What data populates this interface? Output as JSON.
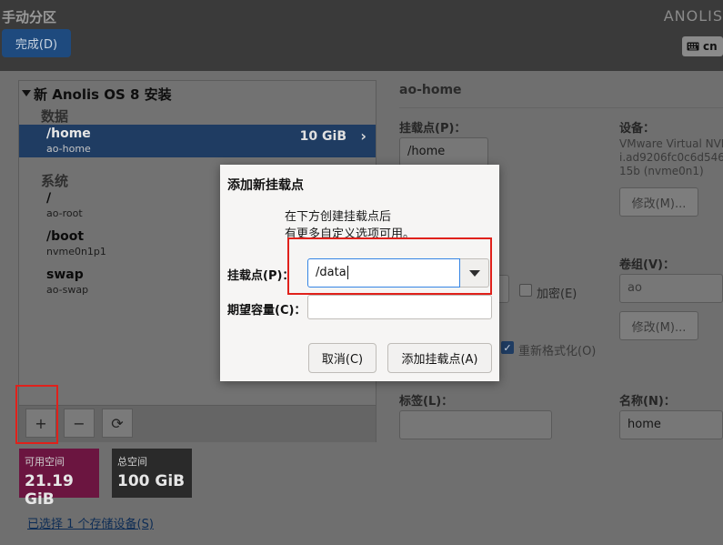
{
  "header": {
    "title": "手动分区",
    "brand": "ANOLIS",
    "done_button": "完成(D)",
    "keyboard_layout": "cn"
  },
  "left_panel": {
    "root_title": "新 Anolis OS 8 安装",
    "sections": [
      {
        "label": "数据",
        "items": [
          {
            "mount": "/home",
            "device": "ao-home",
            "size": "10 GiB",
            "selected": true
          }
        ]
      },
      {
        "label": "系统",
        "items": [
          {
            "mount": "/",
            "device": "ao-root"
          },
          {
            "mount": "/boot",
            "device": "nvme0n1p1"
          },
          {
            "mount": "swap",
            "device": "ao-swap"
          }
        ]
      }
    ],
    "toolbar": {
      "add": "+",
      "remove": "−",
      "refresh": "⟳"
    }
  },
  "space": {
    "available_label": "可用空间",
    "available_value": "21.19 GiB",
    "total_label": "总空间",
    "total_value": "100 GiB"
  },
  "storage_link": "已选择 1 个存储设备(S)",
  "details": {
    "heading": "ao-home",
    "mount_point_label": "挂载点(P)：",
    "mount_point_value": "/home",
    "device_label": "设备：",
    "device_text": [
      "VMware Virtual NVM",
      "i.ad9206fc0c6d546",
      "15b (nvme0n1)"
    ],
    "modify_button": "修改(M)...",
    "encrypt_label": "加密(E)",
    "reformat_label": "重新格式化(O)",
    "volume_group_label": "卷组(V)：",
    "volume_group_value": "ao",
    "modify_vg_button": "修改(M)...",
    "tag_label": "标签(L)：",
    "tag_value": "",
    "name_label": "名称(N)：",
    "name_value": "home"
  },
  "dialog": {
    "title": "添加新挂载点",
    "message_line1": "在下方创建挂载点后",
    "message_line2": "有更多自定义选项可用。",
    "mount_point_label": "挂载点(P)：",
    "mount_point_value": "/data",
    "capacity_label": "期望容量(C)：",
    "capacity_value": "",
    "cancel_button": "取消(C)",
    "add_button": "添加挂载点(A)"
  },
  "colors": {
    "selection": "#1f3c62",
    "available_space": "#6b1540",
    "annotation_red": "#e0211b",
    "focus_blue": "#3584e4"
  }
}
